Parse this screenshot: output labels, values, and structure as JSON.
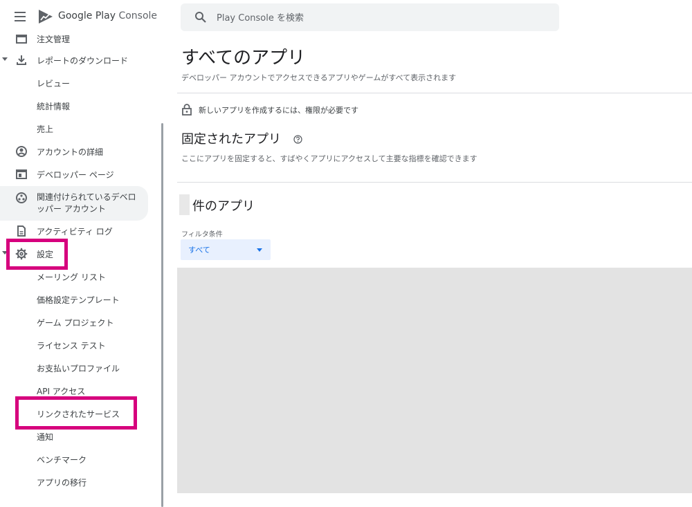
{
  "header": {
    "brand_google": "Google Play",
    "brand_console": "Console",
    "search_placeholder": "Play Console を検索"
  },
  "sidebar": {
    "items": [
      {
        "label": "注文管理",
        "icon": "order-icon"
      },
      {
        "label": "レポートのダウンロード",
        "icon": "download-icon",
        "expanded": true
      },
      {
        "label": "レビュー"
      },
      {
        "label": "統計情報"
      },
      {
        "label": "売上"
      },
      {
        "label": "アカウントの詳細",
        "icon": "account-circle-icon"
      },
      {
        "label": "デベロッパー ページ",
        "icon": "web-page-icon"
      },
      {
        "label": "関連付けられているデベロ",
        "label2": "ッパー アカウント",
        "icon": "linked-accounts-icon",
        "selected": true
      },
      {
        "label": "アクティビティ ログ",
        "icon": "activity-log-icon"
      },
      {
        "label": "設定",
        "icon": "gear-icon",
        "expanded": true
      },
      {
        "label": "メーリング リスト"
      },
      {
        "label": "価格設定テンプレート"
      },
      {
        "label": "ゲーム プロジェクト"
      },
      {
        "label": "ライセンス テスト"
      },
      {
        "label": "お支払いプロファイル"
      },
      {
        "label": "API アクセス"
      },
      {
        "label": "リンクされたサービス"
      },
      {
        "label": "通知"
      },
      {
        "label": "ベンチマーク"
      },
      {
        "label": "アプリの移行"
      }
    ]
  },
  "main": {
    "title": "すべてのアプリ",
    "subtitle": "デベロッパー アカウントでアクセスできるアプリやゲームがすべて表示されます",
    "permission_notice": "新しいアプリを作成するには、権限が必要です",
    "pinned_title": "固定されたアプリ",
    "pinned_description": "ここにアプリを固定すると、すばやくアプリにアクセスして主要な指標を確認できます",
    "count_title": "件のアプリ",
    "filter_label": "フィルタ条件",
    "filter_value": "すべて"
  },
  "colors": {
    "highlight": "#d6007d",
    "accent": "#1a73e8",
    "filter_bg": "#e8f0fe",
    "placeholder_area": "#e3e3e3"
  }
}
